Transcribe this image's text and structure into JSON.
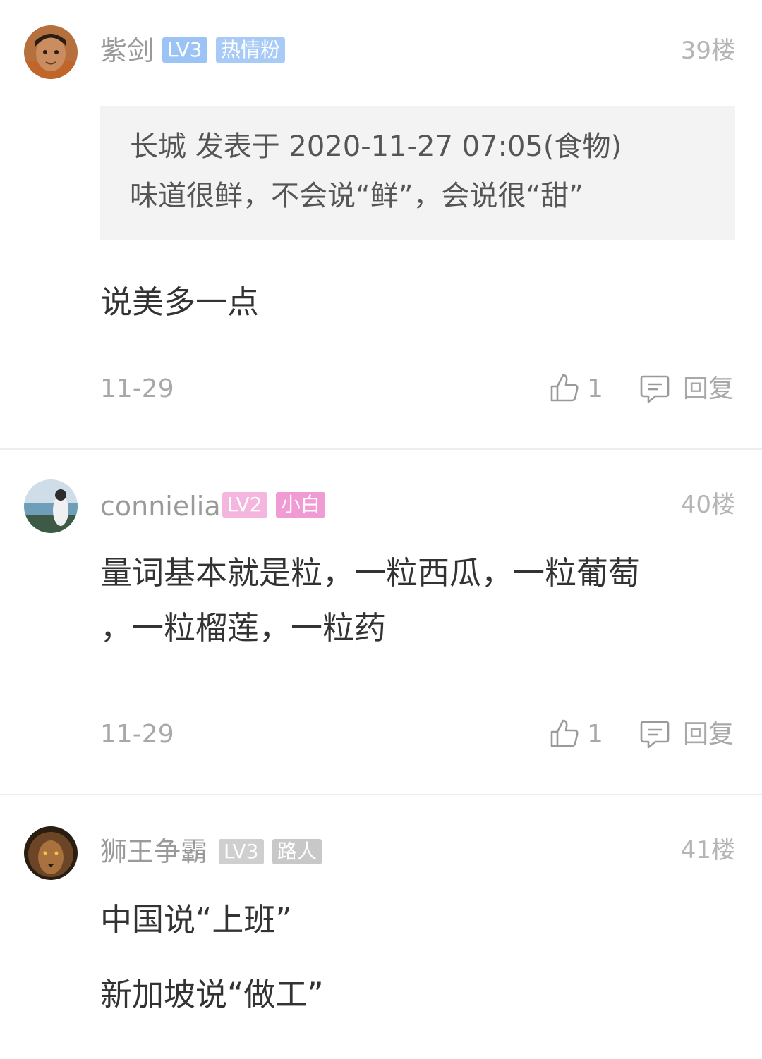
{
  "comments": [
    {
      "username": "紫剑",
      "level": "LV3",
      "tag": "热情粉",
      "floor": "39楼",
      "quote": {
        "line1": "长城 发表于 2020-11-27 07:05(食物)",
        "line2": "味道很鲜，不会说“鲜”，会说很“甜”"
      },
      "body_lines": [
        "说美多一点"
      ],
      "date": "11-29",
      "likes": "1",
      "reply_label": "回复",
      "badge_colors": {
        "level": "#9cc3f5",
        "tag": "#a8caf6"
      }
    },
    {
      "username": "connielia",
      "level": "LV2",
      "tag": "小白",
      "floor": "40楼",
      "body_lines": [
        "量词基本就是粒，一粒西瓜，一粒葡萄",
        "，一粒榴莲，一粒药"
      ],
      "date": "11-29",
      "likes": "1",
      "reply_label": "回复",
      "badge_colors": {
        "level": "#f4b6de",
        "tag": "#f09bd4"
      }
    },
    {
      "username": "狮王争霸",
      "level": "LV3",
      "tag": "路人",
      "floor": "41楼",
      "body_lines": [
        "中国说“上班”",
        "新加坡说“做工”"
      ],
      "badge_colors": {
        "level": "#cfcfcf",
        "tag": "#c8c8c8"
      }
    }
  ],
  "icons": {
    "like": "thumbs-up-icon",
    "reply": "reply-bubble-icon"
  }
}
